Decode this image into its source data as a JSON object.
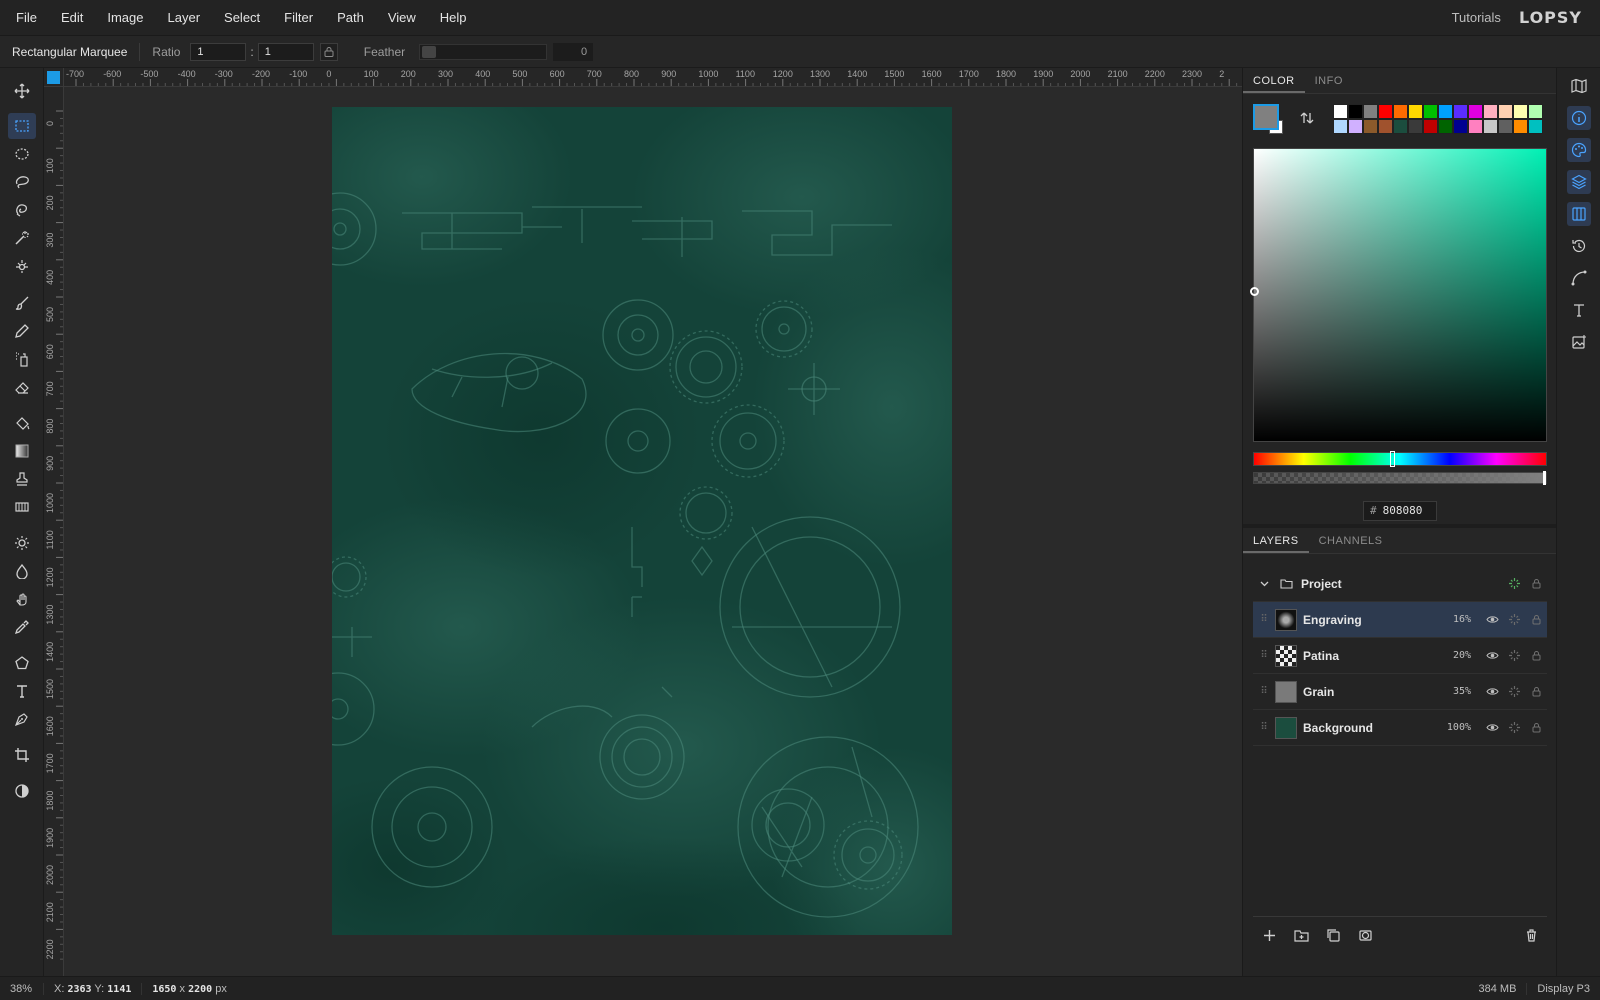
{
  "menubar": {
    "items": [
      "File",
      "Edit",
      "Image",
      "Layer",
      "Select",
      "Filter",
      "Path",
      "View",
      "Help"
    ],
    "tutorials": "Tutorials",
    "logo": "LOPSY"
  },
  "options": {
    "tool_name": "Rectangular Marquee",
    "ratio_label": "Ratio",
    "ratio_w": "1",
    "ratio_sep": ":",
    "ratio_h": "1",
    "feather_label": "Feather",
    "feather_value": "0"
  },
  "rulers": {
    "top_ticks": [
      "-700",
      "-600",
      "-500",
      "-400",
      "-300",
      "-200",
      "-100",
      "0",
      "100",
      "200",
      "300",
      "400",
      "500",
      "600",
      "700",
      "800",
      "900",
      "1000",
      "1100",
      "1200",
      "1300",
      "1400",
      "1500",
      "1600",
      "1700",
      "1800",
      "1900",
      "2000",
      "2100",
      "2200",
      "2300",
      "2"
    ],
    "left_ticks": [
      "0",
      "100",
      "200",
      "300",
      "400",
      "500",
      "600",
      "700",
      "800",
      "900",
      "1000",
      "1100",
      "1200",
      "1300",
      "1400",
      "1500",
      "1600",
      "1700",
      "1800",
      "1900",
      "2000",
      "2100",
      "2200"
    ]
  },
  "color_panel": {
    "tabs": [
      "COLOR",
      "INFO"
    ],
    "foreground": "#808080",
    "background": "#ffffff",
    "hex_prefix": "#",
    "hex": "808080",
    "palette": [
      "#ffffff",
      "#000000",
      "#808080",
      "#ff0000",
      "#ff6a00",
      "#ffd800",
      "#00c000",
      "#00a0ff",
      "#5a2dff",
      "#e000e0",
      "#ffb0c0",
      "#ffd0b0",
      "#ffffb0",
      "#b0ffb0",
      "#b0d8ff",
      "#d0b0ff",
      "#8b5a2b",
      "#a0522d",
      "#1b4d3e",
      "#3a3a3a",
      "#c00000",
      "#006400",
      "#000090",
      "#ff80c0",
      "#c8c8c8",
      "#606060",
      "#ff8c00",
      "#00c0c0"
    ]
  },
  "layers_panel": {
    "tabs": [
      "LAYERS",
      "CHANNELS"
    ],
    "group_name": "Project",
    "layers": [
      {
        "name": "Engraving",
        "opacity": "16%",
        "selected": true
      },
      {
        "name": "Patina",
        "opacity": "20%",
        "selected": false
      },
      {
        "name": "Grain",
        "opacity": "35%",
        "selected": false
      },
      {
        "name": "Background",
        "opacity": "100%",
        "selected": false
      }
    ]
  },
  "status": {
    "zoom": "38%",
    "x_label": "X:",
    "x": "2363",
    "y_label": "Y:",
    "y": "1141",
    "doc_w": "1650",
    "doc_x": "x",
    "doc_h": "2200",
    "doc_unit": "px",
    "memory": "384 MB",
    "display": "Display P3"
  }
}
